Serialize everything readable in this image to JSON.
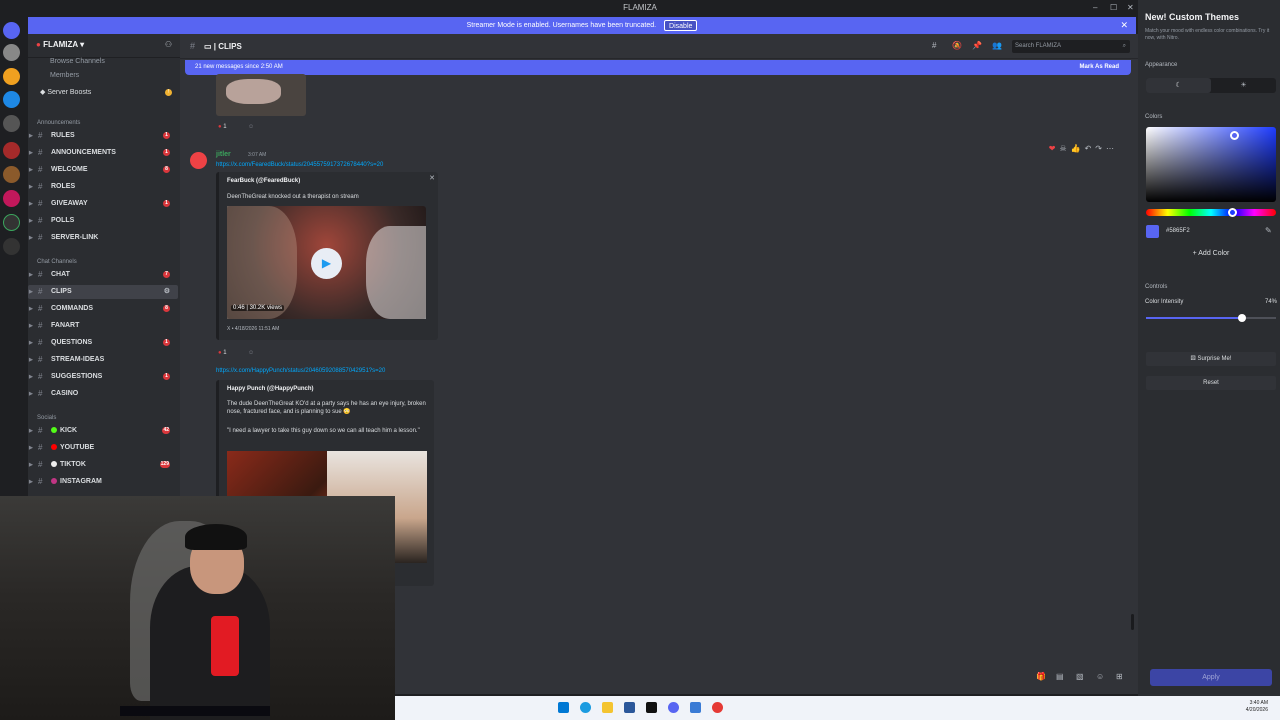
{
  "window": {
    "title": "FLAMIZA"
  },
  "banner": {
    "text": "Streamer Mode is enabled. Usernames have been truncated.",
    "button": "Disable"
  },
  "server": {
    "name": "FLAMIZA"
  },
  "sidebar": {
    "browse": "Browse Channels",
    "members": "Members",
    "boosts": "Server Boosts",
    "categories": {
      "announcements": "Announcements",
      "chat": "Chat Channels",
      "socials": "Socials"
    },
    "channels": [
      {
        "label": "RULES",
        "badge": "1"
      },
      {
        "label": "ANNOUNCEMENTS",
        "badge": "1"
      },
      {
        "label": "WELCOME",
        "badge": "8"
      },
      {
        "label": "ROLES",
        "badge": ""
      },
      {
        "label": "GIVEAWAY",
        "badge": "1"
      },
      {
        "label": "POLLS",
        "badge": ""
      },
      {
        "label": "SERVER-LINK",
        "badge": ""
      },
      {
        "label": "CHAT",
        "badge": "7"
      },
      {
        "label": "CLIPS",
        "badge": ""
      },
      {
        "label": "COMMANDS",
        "badge": "8"
      },
      {
        "label": "FANART",
        "badge": ""
      },
      {
        "label": "QUESTIONS",
        "badge": "1"
      },
      {
        "label": "STREAM-IDEAS",
        "badge": ""
      },
      {
        "label": "SUGGESTIONS",
        "badge": "1"
      },
      {
        "label": "CASINO",
        "badge": ""
      },
      {
        "label": "KICK",
        "badge": "42"
      },
      {
        "label": "YOUTUBE",
        "badge": ""
      },
      {
        "label": "TIKTOK",
        "badge": "129"
      },
      {
        "label": "INSTAGRAM",
        "badge": ""
      }
    ],
    "colors": {
      "badge": "#da373c",
      "kick": "#53fc18",
      "youtube": "#ff0000",
      "tiktok": "#eeeeee",
      "instagram": "#c13584"
    }
  },
  "channel": {
    "name": "CLIPS",
    "search_placeholder": "Search FLAMIZA"
  },
  "newmsg": {
    "text": "21 new messages since 2:50 AM",
    "action": "Mark As Read"
  },
  "messages": {
    "reaction_count": "1",
    "m1": {
      "author": "jitler",
      "time": "3:07 AM",
      "link": "https://x.com/FearedBuck/status/2045575917372678440?s=20",
      "embed_author": "FearBuck (@FearedBuck)",
      "embed_text": "DeenTheGreat knocked out a therapist on stream",
      "video_duration": "0:46",
      "video_views": "30.2K views",
      "footer": "X • 4/18/2026 11:51 AM"
    },
    "m2": {
      "link": "https://x.com/HappyPunch/status/2046059208857042951?s=20",
      "embed_author": "Happy Punch (@HappyPunch)",
      "embed_text1": "The dude DeenTheGreat KO'd at a party says he has an eye injury, broken nose, fractured face, and is planning to sue 😳",
      "embed_text2": "\"I need a lawyer to take this guy down so we can all teach him a lesson.\""
    }
  },
  "theme_panel": {
    "title": "New! Custom Themes",
    "subtitle": "Match your mood with endless color combinations. Try it now, with Nitro.",
    "appearance": "Appearance",
    "colors": "Colors",
    "hex": "#5865F2",
    "add_color": "+ Add Color",
    "controls": "Controls",
    "intensity_label": "Color Intensity",
    "intensity_value": "74%",
    "intensity": 0.74,
    "surprise": "Surprise Me!",
    "reset": "Reset",
    "apply": "Apply",
    "accent": "#5865f2"
  },
  "taskbar": {
    "time": "3:40 AM",
    "date": "4/20/2026"
  }
}
